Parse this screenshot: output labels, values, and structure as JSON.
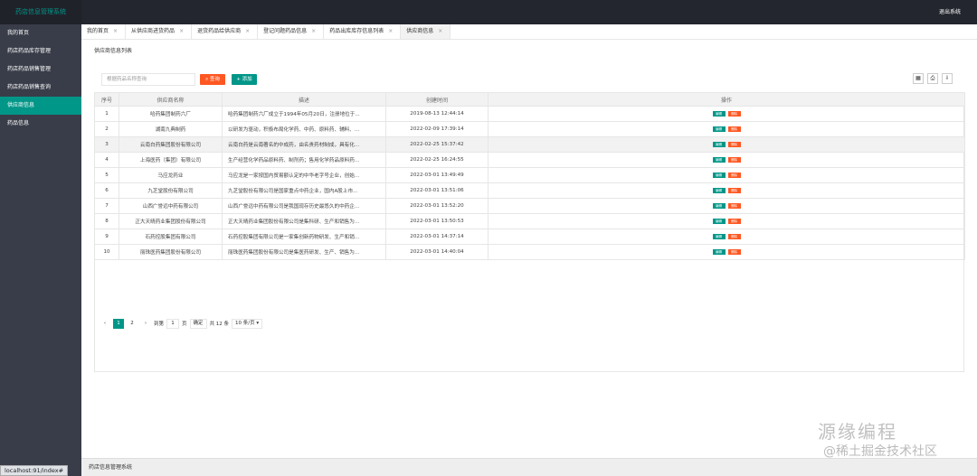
{
  "app": {
    "title": "药店信息管理系统",
    "logout": "退出系统",
    "footer": "药店信息管理系统"
  },
  "sidebar": {
    "items": [
      {
        "label": "我的首页"
      },
      {
        "label": "药店药品库存管理"
      },
      {
        "label": "药店药品销售管理"
      },
      {
        "label": "药店药品销售查询"
      },
      {
        "label": "供应商信息"
      },
      {
        "label": "药品信息"
      }
    ]
  },
  "tabs": [
    {
      "label": "我的首页"
    },
    {
      "label": "从供应商进货药品"
    },
    {
      "label": "退货药品给供应商"
    },
    {
      "label": "登记问题药品信息"
    },
    {
      "label": "药品出库库存信息列表"
    },
    {
      "label": "供应商信息"
    }
  ],
  "page": {
    "crumb": "供应商信息列表"
  },
  "toolbar": {
    "search_placeholder": "根据药品名称查询",
    "search_label": "查询",
    "add_label": "添加",
    "icons": [
      "filter-columns-icon",
      "print-icon",
      "export-icon"
    ]
  },
  "table": {
    "headers": [
      "序号",
      "供应商名称",
      "描述",
      "创建时间",
      "操作"
    ],
    "edit_label": "编辑",
    "delete_label": "删除",
    "rows": [
      {
        "no": "1",
        "name": "哈药集团制药六厂",
        "desc": "哈药集团制药六厂成立于1994年05月20日，注册地位于...",
        "time": "2019-08-13 12:44:14"
      },
      {
        "no": "2",
        "name": "湖南九典制药",
        "desc": "以研发为驱动，积极布局化学药、中药、原料药、辅料、...",
        "time": "2022-02-09 17:39:14"
      },
      {
        "no": "3",
        "name": "云南白药集团股份有限公司",
        "desc": "云南白药是云南著名的中成药，由名贵药材制成，具有化...",
        "time": "2022-02-25 15:37:42"
      },
      {
        "no": "4",
        "name": "上海医药（集团）有限公司",
        "desc": "生产经营化学药品原料药、制剂药；售用化学药品原料药...",
        "time": "2022-02-25 16:24:55"
      },
      {
        "no": "5",
        "name": "马应龙药业",
        "desc": "马应龙是一家按国内贸易额认定的中华老字号企业，创始...",
        "time": "2022-03-01 13:49:49"
      },
      {
        "no": "6",
        "name": "九芝堂股份有限公司",
        "desc": "九芝堂股份有限公司是国家重点中药企业，国内A股上市...",
        "time": "2022-03-01 13:51:06"
      },
      {
        "no": "7",
        "name": "山西广誉远中药有限公司",
        "desc": "山西广誉远中药有限公司是我国现存历史最悠久的中药企...",
        "time": "2022-03-01 13:52:20"
      },
      {
        "no": "8",
        "name": "正大天晴药业集团股份有限公司",
        "desc": "正大天晴药业集团股份有限公司是集科研、生产和销售为...",
        "time": "2022-03-01 13:50:53"
      },
      {
        "no": "9",
        "name": "石药控股集团有限公司",
        "desc": "石药控股集团有限公司是一家集创新药物研发、生产和销...",
        "time": "2022-03-01 14:37:14"
      },
      {
        "no": "10",
        "name": "丽珠医药集团股份有限公司",
        "desc": "丽珠医药集团股份有限公司是集医药研发、生产、销售为...",
        "time": "2022-03-01 14:40:04"
      }
    ]
  },
  "pager": {
    "pages": [
      "1",
      "2"
    ],
    "goto_label": "到第",
    "goto_value": "1",
    "page_unit": "页",
    "confirm_label": "确定",
    "total": "共 12 条",
    "per_page": "10 条/页"
  },
  "statusbar": "localhost:91/index#",
  "watermark": {
    "line1": "源缘编程",
    "line2": "@稀土掘金技术社区"
  }
}
